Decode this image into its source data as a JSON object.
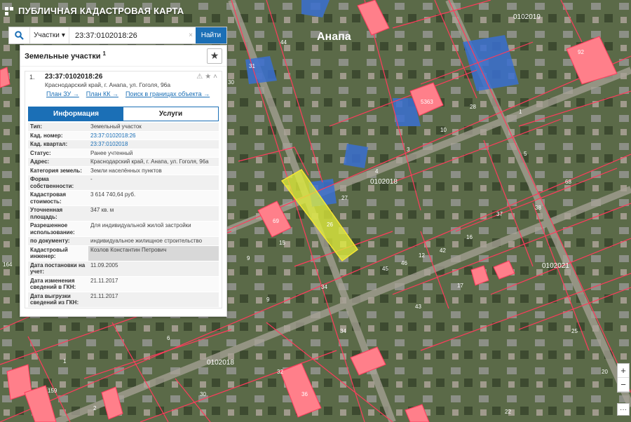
{
  "app": {
    "title": "ПУБЛИЧНАЯ КАДАСТРОВАЯ КАРТА"
  },
  "search": {
    "type": "Участки",
    "value": "23:37:0102018:26",
    "clear": "×",
    "submit": "Найти"
  },
  "results": {
    "title": "Земельные участки",
    "count": "1",
    "item": {
      "index": "1.",
      "cad_number": "23:37:0102018:26",
      "address": "Краснодарский край, г. Анапа, ул. Гоголя, 96а",
      "links": [
        "План ЗУ →",
        "План КК →",
        "Поиск в границах объекта →"
      ],
      "tabs": [
        "Информация",
        "Услуги"
      ],
      "attributes": [
        {
          "k": "Тип:",
          "v": "Земельный участок"
        },
        {
          "k": "Кад. номер:",
          "v": "23:37:0102018:26"
        },
        {
          "k": "Кад. квартал:",
          "v": "23:37:0102018"
        },
        {
          "k": "Статус:",
          "v": "Ранее учтенный"
        },
        {
          "k": "Адрес:",
          "v": "Краснодарский край, г. Анапа, ул. Гоголя, 96а"
        },
        {
          "k": "Категория земель:",
          "v": "Земли населённых пунктов"
        },
        {
          "k": "Форма собственности:",
          "v": "-"
        },
        {
          "k": "Кадастровая стоимость:",
          "v": "3 614 740,64 руб."
        },
        {
          "k": "Уточненная площадь:",
          "v": "347 кв. м"
        },
        {
          "k": "Разрешенное использование:",
          "v": "Для индивидуальной жилой застройки"
        },
        {
          "k": "по документу:",
          "v": "индивидуальное жилищное строительство"
        },
        {
          "k": "Кадастровый инженер:",
          "v": "Козлов Константин Петрович"
        },
        {
          "k": "Дата постановки на учет:",
          "v": "11.09.2005"
        },
        {
          "k": "Дата изменения сведений в ГКН:",
          "v": "21.11.2017"
        },
        {
          "k": "Дата выгрузки сведений из ГКН:",
          "v": "21.11.2017"
        }
      ]
    }
  },
  "map": {
    "city": "Анапа",
    "quarters": [
      "0102019",
      "0102018",
      "0102021",
      "0102018"
    ],
    "parcel_labels": [
      "44",
      "31",
      "30",
      "31",
      "5363",
      "28",
      "1",
      "10",
      "3",
      "4",
      "5",
      "27",
      "26",
      "69",
      "15",
      "9",
      "16",
      "37",
      "38",
      "68",
      "12",
      "42",
      "45",
      "46",
      "14",
      "12",
      "17",
      "13",
      "34",
      "45",
      "43",
      "4",
      "9",
      "34",
      "42",
      "33",
      "30",
      "32",
      "36",
      "1",
      "2",
      "159",
      "150",
      "160",
      "6",
      "25",
      "2",
      "22",
      "71",
      "66",
      "8",
      "127",
      "164",
      "27",
      "20",
      "92",
      "12",
      "1"
    ]
  },
  "controls": {
    "zoom_in": "+",
    "zoom_out": "−",
    "more": "···"
  },
  "colors": {
    "accent": "#1b6fb6",
    "parcel_border": "#ff3b5c",
    "parcel_fill": "#ff7f8a",
    "selected_fill": "#e3f03a"
  }
}
